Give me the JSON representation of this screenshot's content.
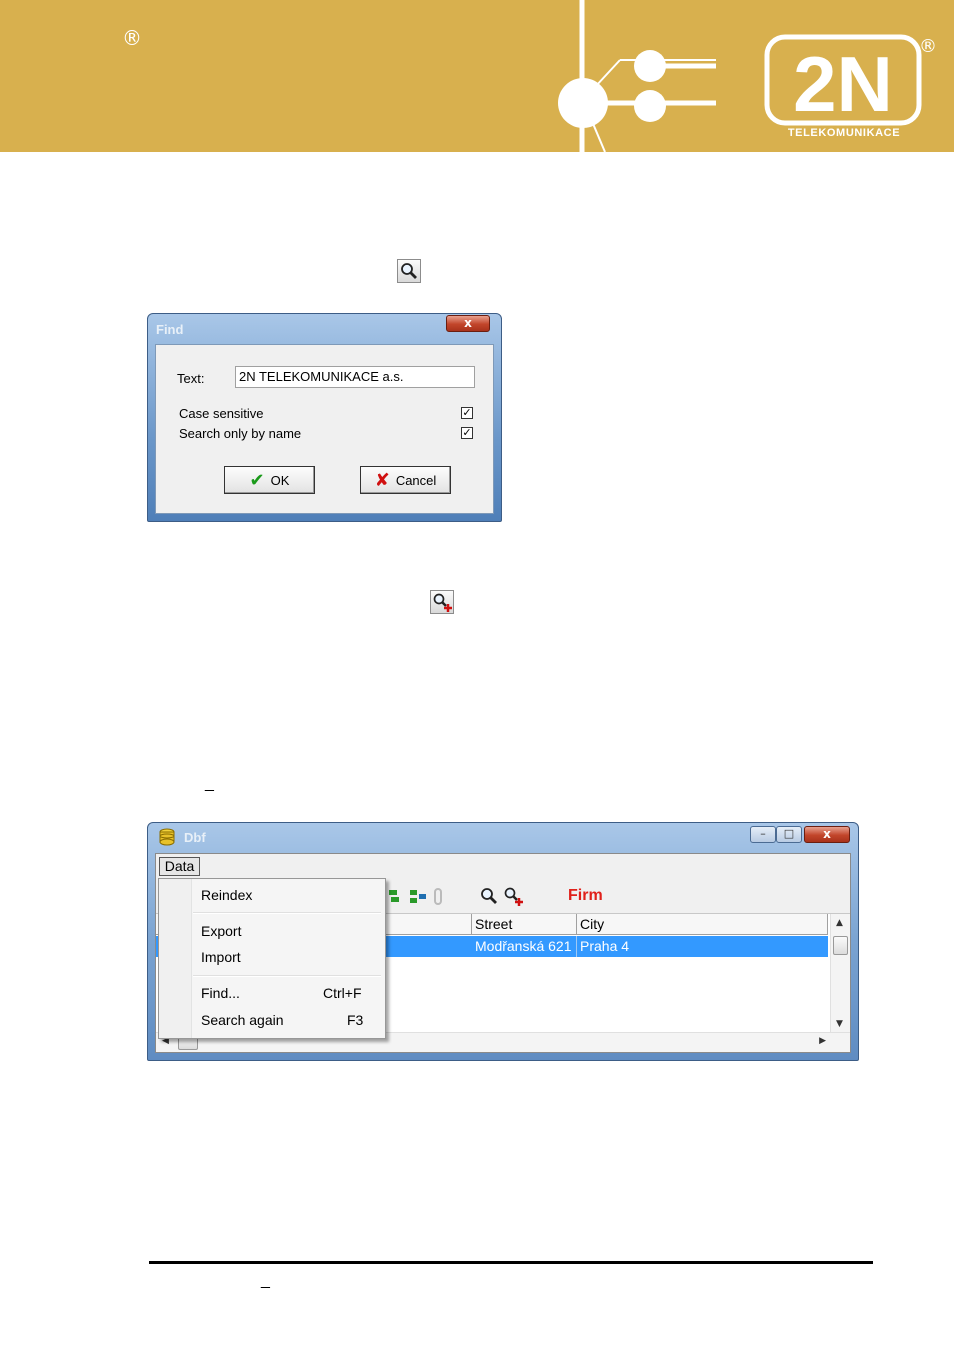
{
  "header": {
    "reg_mark_left": "®",
    "brand_logo": "2N",
    "brand_sub": "TELEKOMUNIKACE",
    "reg_mark_right": "®",
    "color": "#d8b04e"
  },
  "icons": {
    "find_icon": "search-icon",
    "search_again_icon": "search-again-icon"
  },
  "find_dialog": {
    "title": "Find",
    "close_label": "x",
    "text_label": "Text:",
    "text_value": "2N TELEKOMUNIKACE a.s.",
    "case_sensitive_label": "Case sensitive",
    "case_sensitive_checked": true,
    "search_by_name_label": "Search only by name",
    "search_by_name_checked": true,
    "ok_label": "OK",
    "cancel_label": "Cancel"
  },
  "underscore_marks": [
    "_",
    "_"
  ],
  "dbf_window": {
    "title": "Dbf",
    "minimize_label": "–",
    "maximize_label": "□",
    "close_label": "x",
    "menubar": {
      "data_label": "Data"
    },
    "toolbar_title": "Firm",
    "columns": [
      "Street",
      "City"
    ],
    "selected_row": {
      "street": "Modřanská 621",
      "city": "Praha 4"
    },
    "menu": {
      "items": [
        {
          "label": "Reindex",
          "shortcut": ""
        },
        {
          "label": "Export",
          "shortcut": ""
        },
        {
          "label": "Import",
          "shortcut": ""
        },
        {
          "label": "Find...",
          "shortcut": "Ctrl+F"
        },
        {
          "label": "Search again",
          "shortcut": "F3"
        }
      ]
    }
  }
}
